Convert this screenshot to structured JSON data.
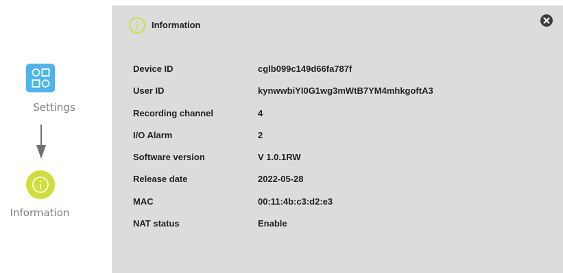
{
  "flow": {
    "settings_label": "Settings",
    "information_label": "Information",
    "settings_icon": "settings-grid-icon",
    "information_icon": "info-icon",
    "arrow_icon": "arrow-down-icon"
  },
  "panel": {
    "title": "Information",
    "title_icon": "info-icon",
    "close_icon": "close-icon",
    "rows": [
      {
        "key": "Device ID",
        "value": "cglb099c149d66fa787f"
      },
      {
        "key": "User ID",
        "value": "kynwwbiYI0G1wg3mWtB7YM4mhkgoftA3"
      },
      {
        "key": "Recording channel",
        "value": "4"
      },
      {
        "key": "I/O Alarm",
        "value": "2"
      },
      {
        "key": "Software version",
        "value": "V 1.0.1RW"
      },
      {
        "key": "Release date",
        "value": "2022-05-28"
      },
      {
        "key": "MAC",
        "value": "00:11:4b:c3:d2:e3"
      },
      {
        "key": "NAT status",
        "value": "Enable"
      }
    ]
  },
  "colors": {
    "settings_accent": "#4db5ee",
    "info_accent": "#cfde3a",
    "panel_bg": "#dcdcdc"
  }
}
